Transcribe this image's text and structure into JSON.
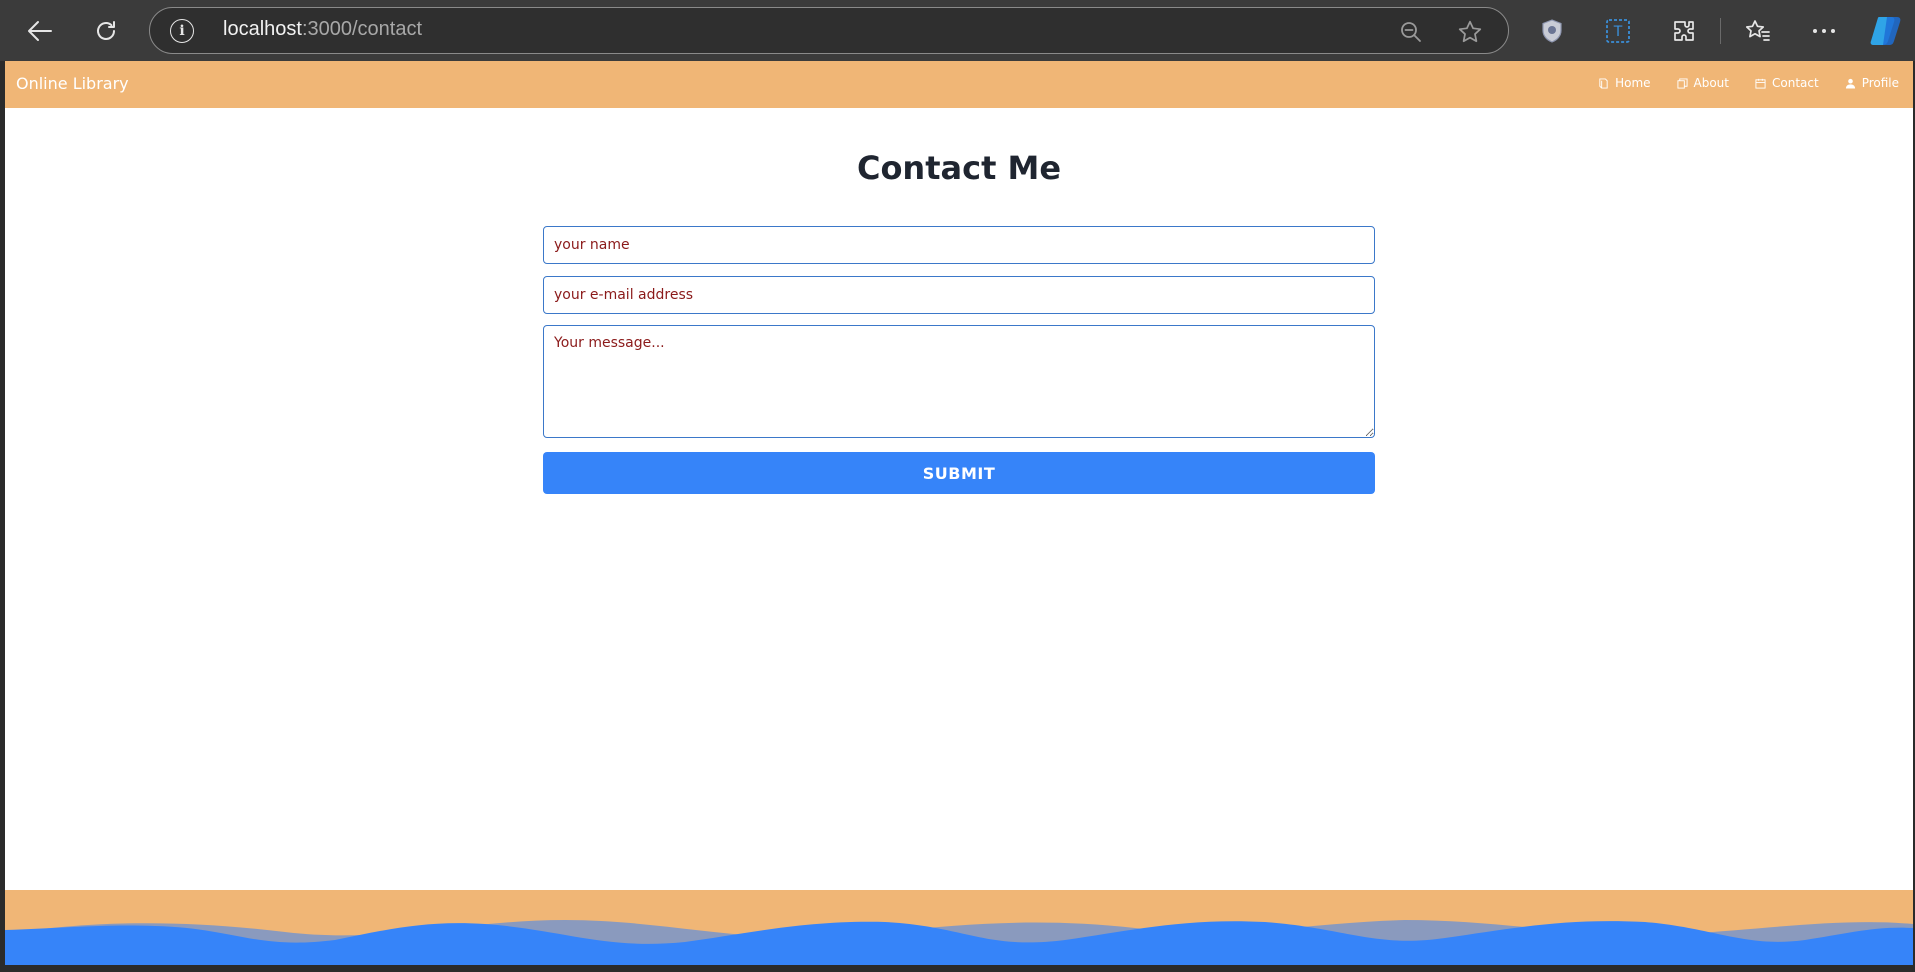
{
  "browser": {
    "url_host": "localhost",
    "url_path": ":3000/contact",
    "icons": [
      "back-arrow-icon",
      "refresh-icon",
      "info-icon",
      "zoom-out-icon",
      "star-icon",
      "shield-icon",
      "translate-icon",
      "extensions-icon",
      "favorites-icon",
      "more-icon",
      "copilot-icon"
    ]
  },
  "navbar": {
    "brand": "Online Library",
    "links": [
      {
        "label": "Home",
        "icon": "book-icon"
      },
      {
        "label": "About",
        "icon": "pages-icon"
      },
      {
        "label": "Contact",
        "icon": "calendar-icon"
      },
      {
        "label": "Profile",
        "icon": "user-icon"
      }
    ]
  },
  "main": {
    "title": "Contact Me",
    "name_placeholder": "your name",
    "email_placeholder": "your e-mail address",
    "message_placeholder": "Your message...",
    "submit_label": "SUBMIT"
  },
  "colors": {
    "nav_bg": "#f0b676",
    "button": "#3684f9",
    "wave": "#3684f9",
    "input_border": "#3b78c9",
    "placeholder": "#8b1a1a"
  }
}
